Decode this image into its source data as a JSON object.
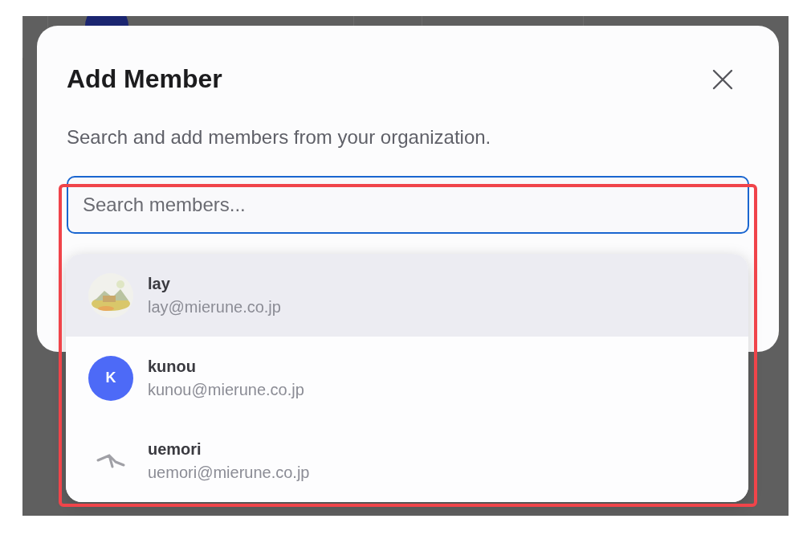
{
  "dialog": {
    "title": "Add Member",
    "description": "Search and add members from your organization.",
    "search": {
      "placeholder": "Search members..."
    },
    "results": [
      {
        "kind": "picture",
        "name": "lay",
        "email": "lay@mierune.co.jp",
        "selected": true
      },
      {
        "kind": "letter",
        "letter": "K",
        "name": "kunou",
        "email": "kunou@mierune.co.jp",
        "selected": false
      },
      {
        "kind": "icon",
        "name": "uemori",
        "email": "uemori@mierune.co.jp",
        "selected": false
      }
    ]
  }
}
